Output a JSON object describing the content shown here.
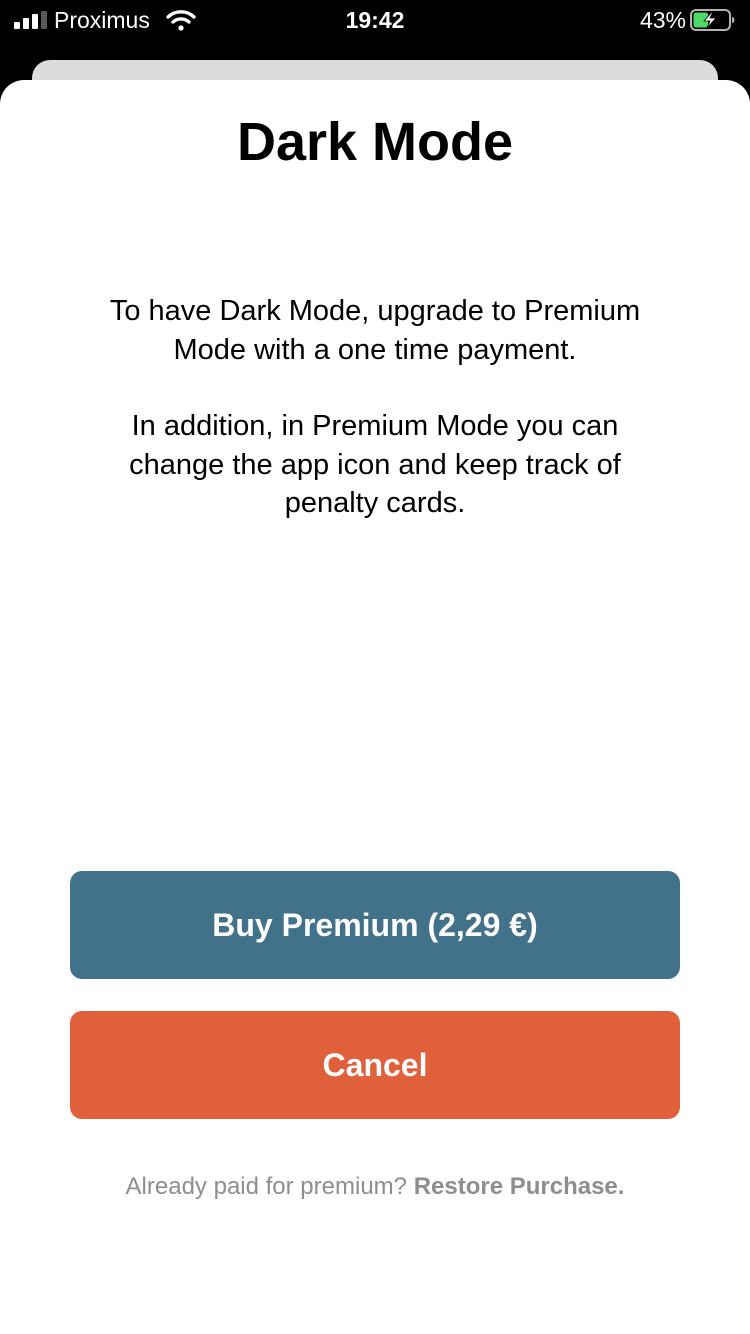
{
  "status_bar": {
    "carrier": "Proximus",
    "time": "19:42",
    "battery_percent": "43%",
    "battery_level": 0.43,
    "charging": true,
    "signal_bars": 3,
    "icons": {
      "signal": "cellular-signal-icon",
      "wifi": "wifi-icon",
      "battery": "battery-charging-icon"
    }
  },
  "dialog": {
    "title": "Dark Mode",
    "message_1": "To have Dark Mode, upgrade to Premium Mode with a one time payment.",
    "message_2": "In addition, in Premium Mode you can change the app icon and keep track of penalty cards.",
    "buy_button_label": "Buy Premium (2,29 €)",
    "cancel_button_label": "Cancel",
    "footer_text": "Already paid for premium?",
    "restore_link_label": "Restore Purchase."
  },
  "colors": {
    "buy_button": "#42718a",
    "cancel_button": "#e0603b",
    "footer_text": "#8e8e8e",
    "battery_charge": "#4cd964"
  }
}
